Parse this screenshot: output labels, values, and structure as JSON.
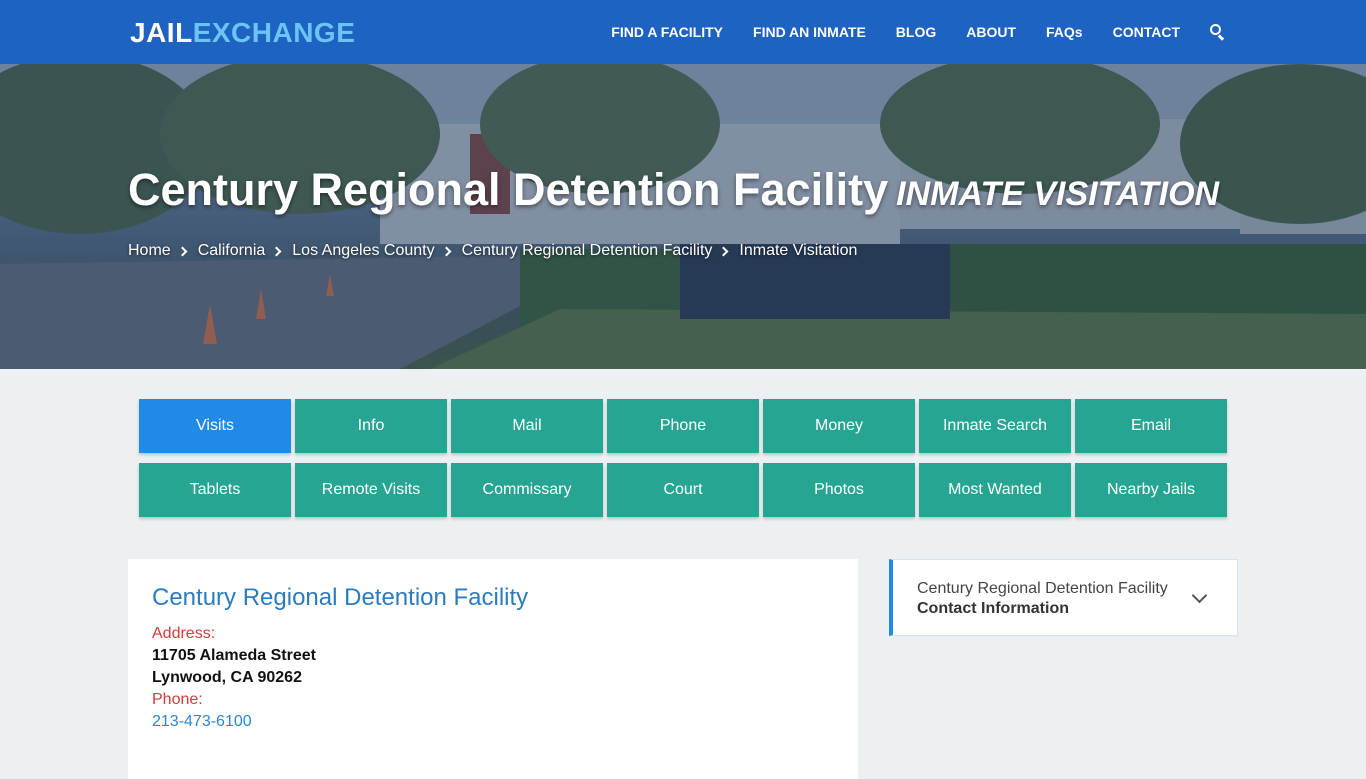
{
  "nav": {
    "logo_part1": "JAIL",
    "logo_part2": "EXCHANGE",
    "links": [
      "FIND A FACILITY",
      "FIND AN INMATE",
      "BLOG",
      "ABOUT",
      "FAQs",
      "CONTACT"
    ],
    "search_icon": "search-icon",
    "colors": {
      "bar": "#1e63c2",
      "logo_accent": "#6cc3f5"
    }
  },
  "hero": {
    "title": "Century Regional Detention Facility",
    "subtitle": "INMATE VISITATION",
    "breadcrumb": [
      "Home",
      "California",
      "Los Angeles County",
      "Century Regional Detention Facility",
      "Inmate Visitation"
    ]
  },
  "tabs": {
    "items": [
      "Visits",
      "Info",
      "Mail",
      "Phone",
      "Money",
      "Inmate Search",
      "Email",
      "Tablets",
      "Remote Visits",
      "Commissary",
      "Court",
      "Photos",
      "Most Wanted",
      "Nearby Jails"
    ],
    "active": "Visits",
    "colors": {
      "default": "#27a593",
      "active": "#2189e8"
    }
  },
  "facility": {
    "name": "Century Regional Detention Facility",
    "address_label": "Address:",
    "address_line1": "11705 Alameda Street",
    "address_line2": "Lynwood, CA 90262",
    "phone_label": "Phone:",
    "phone": "213-473-6100"
  },
  "sidebar": {
    "line1": "Century Regional Detention Facility",
    "line2": "Contact Information",
    "toggle_icon": "chevron-down-icon"
  }
}
